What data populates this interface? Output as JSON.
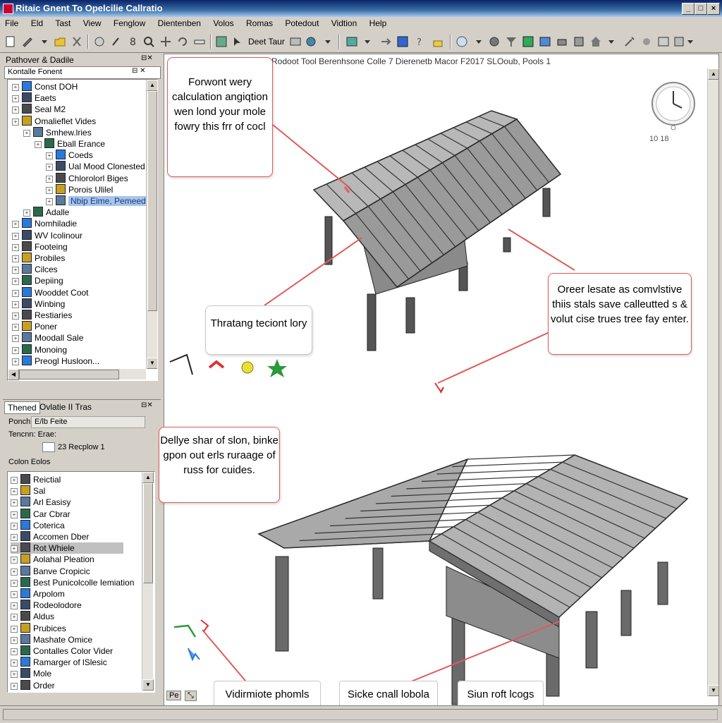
{
  "window": {
    "title": "Ritaic Gnent To Opelcilie Callratio"
  },
  "menu": [
    "File",
    "Eld",
    "Tast",
    "View",
    "Fenglow",
    "Dientenben",
    "Volos",
    "Romas",
    "Potedout",
    "Vidtion",
    "Help"
  ],
  "toolbar": {
    "dropdown_text": "Deet Taur"
  },
  "left_top": {
    "header": "Pathover & Dadile",
    "filter": "Kontalle Fonent",
    "items": [
      {
        "label": "Const DOH",
        "indent": 0
      },
      {
        "label": "Eaets",
        "indent": 0
      },
      {
        "label": "Seal M2",
        "indent": 0
      },
      {
        "label": "Omalieflet Vides",
        "indent": 0
      },
      {
        "label": "Smhew.lries",
        "indent": 1
      },
      {
        "label": "Eball Erance",
        "indent": 2
      },
      {
        "label": "Coeds",
        "indent": 3
      },
      {
        "label": "Ual Mood Clonested",
        "indent": 3
      },
      {
        "label": "Chlorolorl Biges",
        "indent": 3
      },
      {
        "label": "Porois Ulilel",
        "indent": 3
      },
      {
        "label": "Nbip Eime, Pemeed",
        "indent": 3,
        "selected": true
      },
      {
        "label": "Adalle",
        "indent": 1
      },
      {
        "label": "Nomhiladie",
        "indent": 0
      },
      {
        "label": "WV Icolinour",
        "indent": 0
      },
      {
        "label": "Footeing",
        "indent": 0
      },
      {
        "label": "Probiles",
        "indent": 0
      },
      {
        "label": "Cilces",
        "indent": 0
      },
      {
        "label": "Depiing",
        "indent": 0
      },
      {
        "label": "Wooddet Coot",
        "indent": 0
      },
      {
        "label": "Winbing",
        "indent": 0
      },
      {
        "label": "Restiaries",
        "indent": 0
      },
      {
        "label": "Poner",
        "indent": 0
      },
      {
        "label": "Moodall Sale",
        "indent": 0
      },
      {
        "label": "Monoing",
        "indent": 0
      },
      {
        "label": "Preogl Husloon...",
        "indent": 0
      }
    ]
  },
  "left_bottom": {
    "tabs": [
      "Thened",
      "Ovlatie II Tras"
    ],
    "field1_label": "Ponch is:",
    "field1_value": "E/lb Feite",
    "field2_label": "Tencnn: Erae:",
    "field3_value": "23 Recplow 1",
    "section_label": "Colon Eolos",
    "items": [
      {
        "label": "Reictial"
      },
      {
        "label": "Sal"
      },
      {
        "label": "Arl Easisy"
      },
      {
        "label": "Car Cbrar"
      },
      {
        "label": "Coterica"
      },
      {
        "label": "Accomen Dber"
      },
      {
        "label": "Rot Whiele",
        "selected": true
      },
      {
        "label": "Aolahal Pleation"
      },
      {
        "label": "Banve Cropicic"
      },
      {
        "label": "Best Punicolcolle Iemiation"
      },
      {
        "label": "Arpolom"
      },
      {
        "label": "Rodeolodore"
      },
      {
        "label": "Aldus"
      },
      {
        "label": "Prubices"
      },
      {
        "label": "Mashate Omice"
      },
      {
        "label": "Contalles Color Vider"
      },
      {
        "label": "Ramarger of lSlesic"
      },
      {
        "label": "Mole"
      },
      {
        "label": "Order"
      }
    ]
  },
  "viewport": {
    "title": "Rodoot Tool Berenhsone Colle 7 Dierenetb Macor F2017   SLOoub, Pools 1",
    "clock_readout": "10 18",
    "callouts": {
      "top_left": "Forwont wery calculation angiqtion wen lond your mole fowry this frr of cocl",
      "mid_left": "Thratang teciont lory",
      "right": "Oreer lesate as comvlstive thiis stals save calleutted s & volut cise trues tree fay enter.",
      "lower_left": "Dellye shar of slon, binke gpon out erls ruraage of russ for cuides."
    },
    "bottom_labels": [
      "Vidirmiote phomls",
      "Sicke cnall lobola",
      "Siun roft lcogs"
    ]
  }
}
